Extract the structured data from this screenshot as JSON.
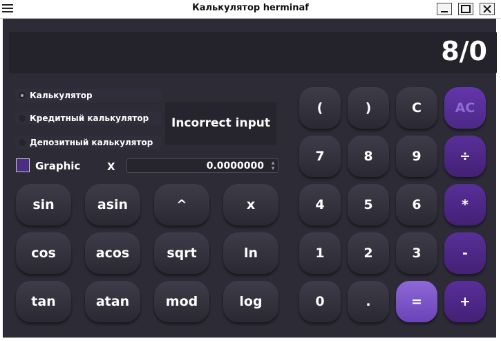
{
  "window": {
    "title": "Калькулятор herminaf"
  },
  "display": {
    "text": "8/0"
  },
  "modes": [
    {
      "label": "Калькулятор",
      "selected": true
    },
    {
      "label": "Кредитный калькулятор",
      "selected": false
    },
    {
      "label": "Депозитный калькулятор",
      "selected": false
    }
  ],
  "message": "Incorrect input",
  "graphic": {
    "label": "Graphic",
    "checked": false
  },
  "x_field": {
    "label": "X",
    "value": "0.0000000"
  },
  "functions": [
    [
      "sin",
      "asin",
      "^",
      "x"
    ],
    [
      "cos",
      "acos",
      "sqrt",
      "ln"
    ],
    [
      "tan",
      "atan",
      "mod",
      "log"
    ]
  ],
  "keypad": [
    [
      "(",
      ")",
      "C",
      "AC"
    ],
    [
      "7",
      "8",
      "9",
      "÷"
    ],
    [
      "4",
      "5",
      "6",
      "*"
    ],
    [
      "1",
      "2",
      "3",
      "-"
    ],
    [
      "0",
      ".",
      "=",
      "+"
    ]
  ],
  "colors": {
    "background": "#2c2b36",
    "accent": "#4c2886",
    "equals": "#7b55c7"
  }
}
